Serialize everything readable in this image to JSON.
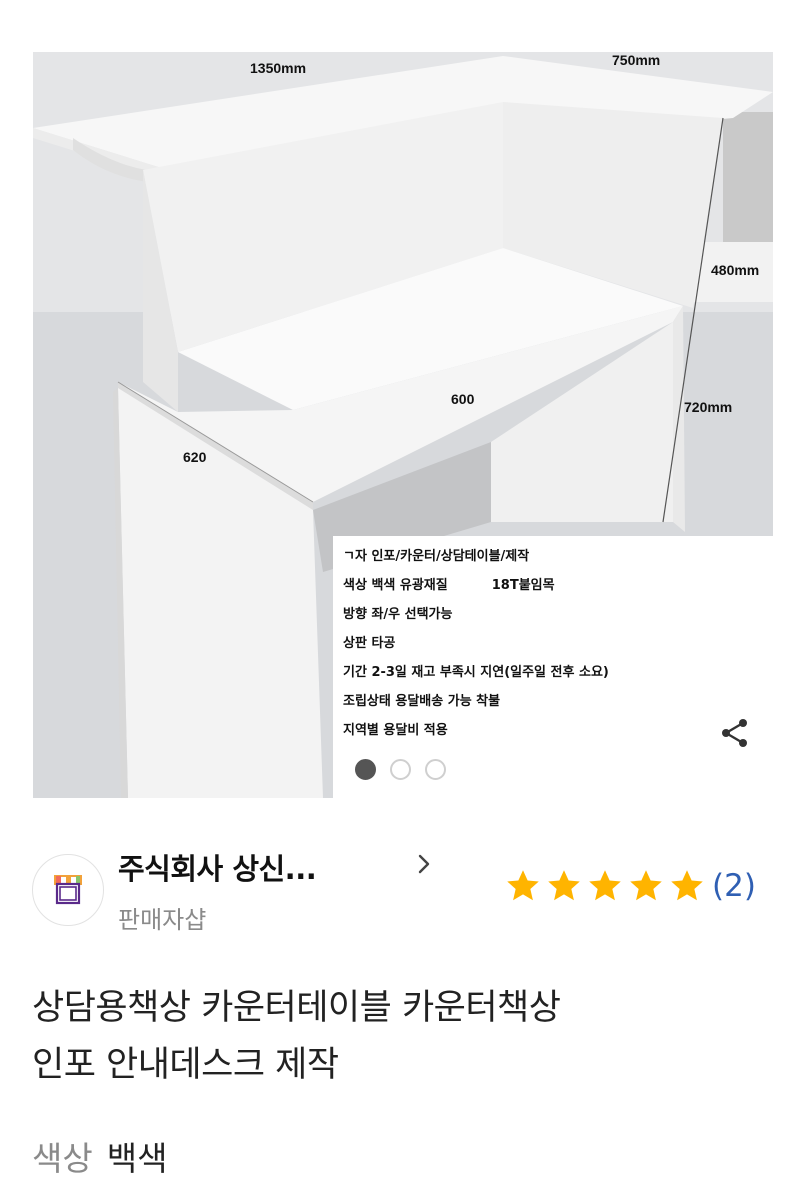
{
  "product_image": {
    "dimensions": {
      "width_long": "1350mm",
      "width_short": "750mm",
      "depth_side": "480mm",
      "height": "720mm",
      "inner_width": "600",
      "inner_depth": "620"
    },
    "spec_lines": [
      "ㄱ자 인포/카운터/상담테이블/제작",
      "색상 백색 유광재질",
      "방향 좌/우 선택가능",
      "상판 타공",
      "기간 2-3일 재고 부족시 지연(일주일 전후 소요)",
      "조립상태 용달배송 가능 착불",
      "지역별 용달비 적용"
    ],
    "spec_line2_extra": "18T붙임목",
    "carousel": {
      "total": 3,
      "active_index": 0
    }
  },
  "seller": {
    "name": "주식회사 상신...",
    "subtitle": "판매자샵",
    "rating": {
      "stars": 5,
      "review_count": "(2)"
    }
  },
  "product": {
    "title_line1": "상담용책상 카운터테이블 카운터책상",
    "title_line2": "인포 안내데스크 제작",
    "option_label": "색상",
    "option_value": "백색"
  },
  "colors": {
    "star": "#ffb400",
    "review_link": "#2f5fb3",
    "muted_text": "#8a8a8a"
  }
}
